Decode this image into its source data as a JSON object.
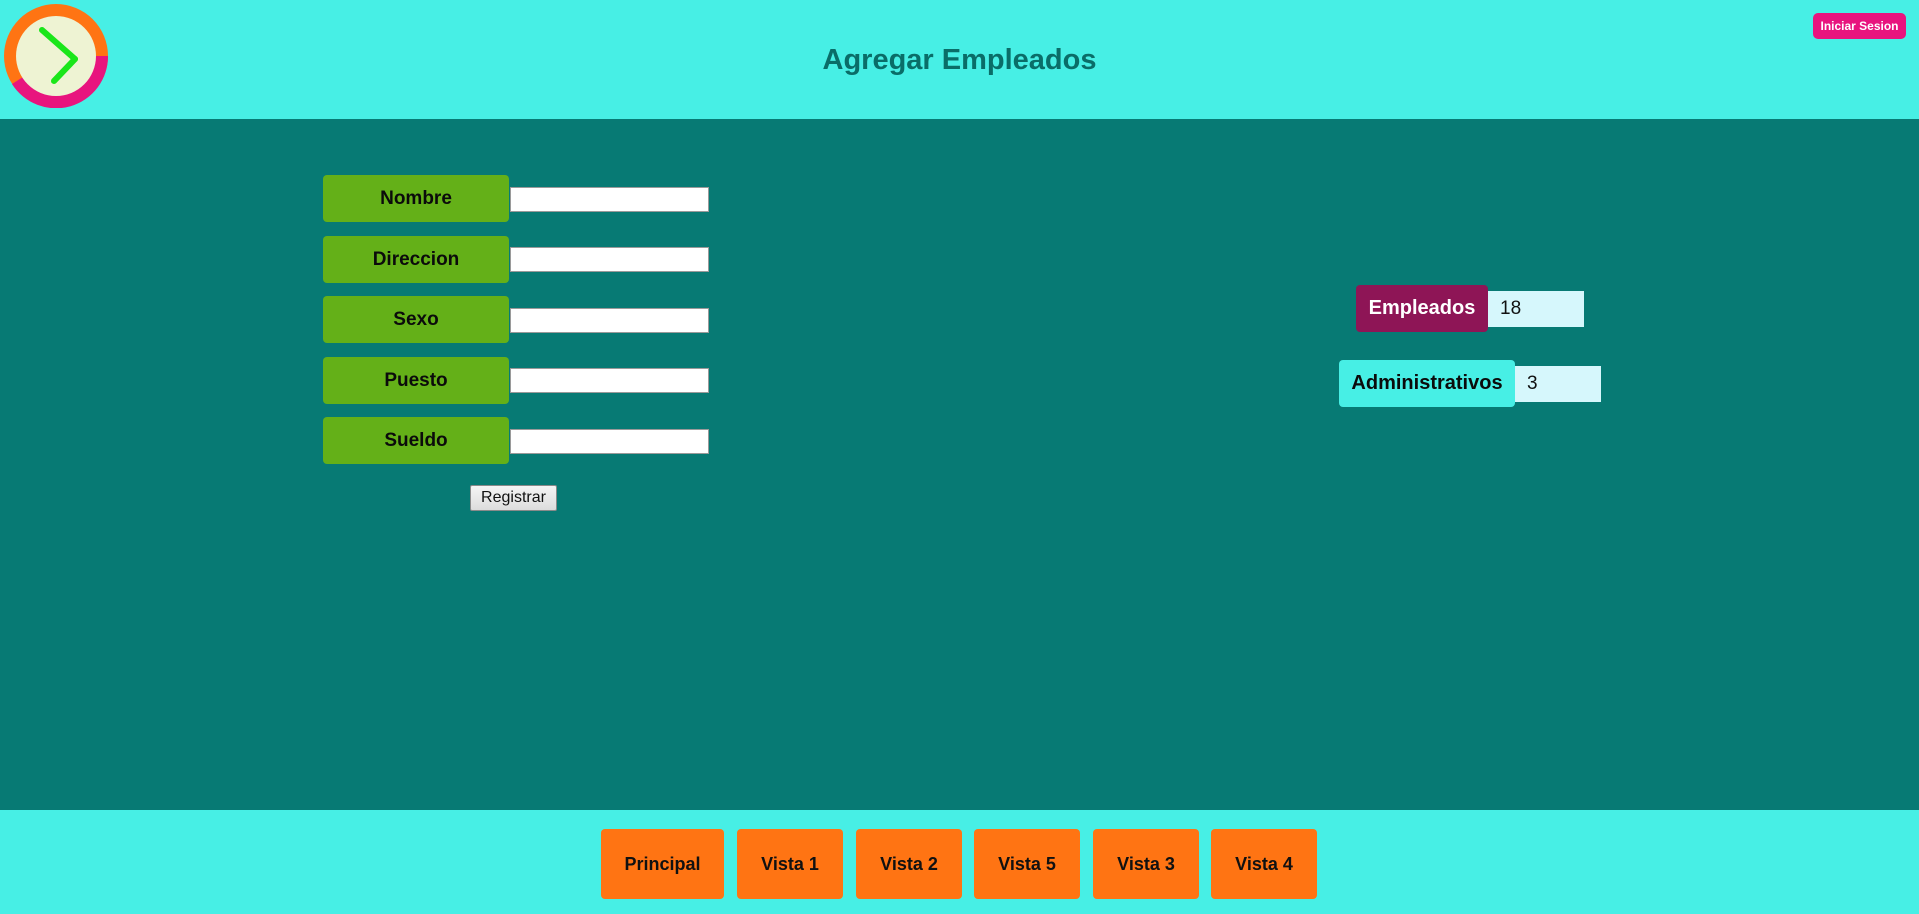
{
  "header": {
    "title": "Agregar Empleados",
    "login_label": "Iniciar Sesion"
  },
  "logo": {
    "icon": "clock-icon",
    "colors": {
      "face": "#eef3d3",
      "ring_top": "#ff7413",
      "ring_bottom": "#e8147e",
      "hands": "#1ae61a"
    }
  },
  "form": {
    "fields": [
      {
        "label": "Nombre",
        "value": ""
      },
      {
        "label": "Direccion",
        "value": ""
      },
      {
        "label": "Sexo",
        "value": ""
      },
      {
        "label": "Puesto",
        "value": ""
      },
      {
        "label": "Sueldo",
        "value": ""
      }
    ],
    "submit_label": "Registrar"
  },
  "stats": {
    "empleados": {
      "label": "Empleados",
      "value": "18"
    },
    "administrativos": {
      "label": "Administrativos",
      "value": "3"
    }
  },
  "nav": {
    "items": [
      {
        "label": "Principal"
      },
      {
        "label": "Vista 1"
      },
      {
        "label": "Vista 2"
      },
      {
        "label": "Vista 5"
      },
      {
        "label": "Vista 3"
      },
      {
        "label": "Vista 4"
      }
    ]
  },
  "colors": {
    "header_bg": "#47efe5",
    "main_bg": "#077a74",
    "title": "#0a6d68",
    "field_label_bg": "#64b018",
    "empleados_bg": "#8e1556",
    "administrativos_bg": "#47efe5",
    "stat_value_bg": "#d6f7fc",
    "nav_button_bg": "#ff7413",
    "login_bg": "#e8147e"
  }
}
